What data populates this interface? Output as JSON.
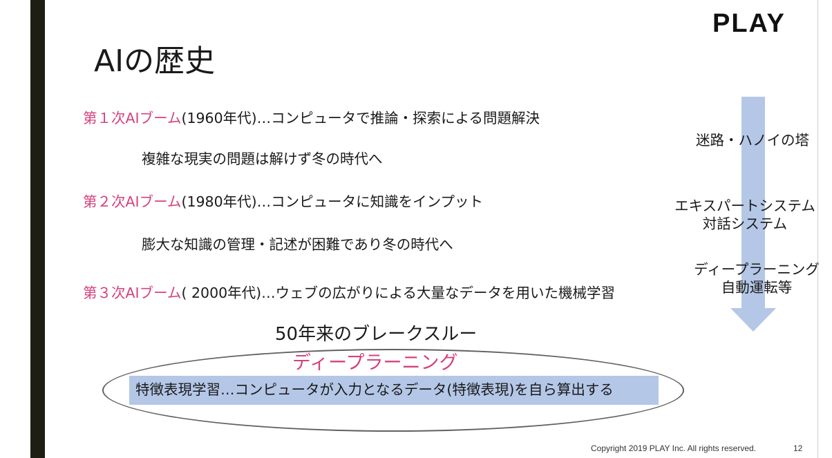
{
  "header": {
    "logo_text": "PLAY",
    "title": "AIの歴史"
  },
  "booms": [
    {
      "era": "第１次AIブーム",
      "text": "(1960年代)…コンピュータで推論・探索による問題解決"
    },
    {
      "text": "複雑な現実の問題は解けず冬の時代へ"
    },
    {
      "era": "第２次AIブーム",
      "text": "(1980年代)…コンピュータに知識をインプット"
    },
    {
      "text": "膨大な知識の管理・記述が困難であり冬の時代へ"
    },
    {
      "era": "第３次AIブーム",
      "text": "( 2000年代)…ウェブの広がりによる大量なデータを用いた機械学習"
    }
  ],
  "breakthrough": {
    "heading": "50年来のブレークスルー",
    "keyword": "ディープラーニング",
    "description": "特徴表現学習…コンピュータが入力となるデータ(特徴表現)を自ら算出する"
  },
  "timeline": {
    "labels": [
      {
        "line1": "迷路・ハノイの塔",
        "line2": ""
      },
      {
        "line1": "エキスパートシステム",
        "line2": "対話システム"
      },
      {
        "line1": "ディープラーニング",
        "line2": "自動運転等"
      }
    ],
    "arrow_color": "#b4c7e7"
  },
  "footer": {
    "copyright": "Copyright 2019 PLAY Inc. All rights reserved.",
    "page_number": "12"
  },
  "colors": {
    "accent": "#d6407e",
    "highlight": "#b4c7e7",
    "left_bar": "#1e1e14"
  }
}
